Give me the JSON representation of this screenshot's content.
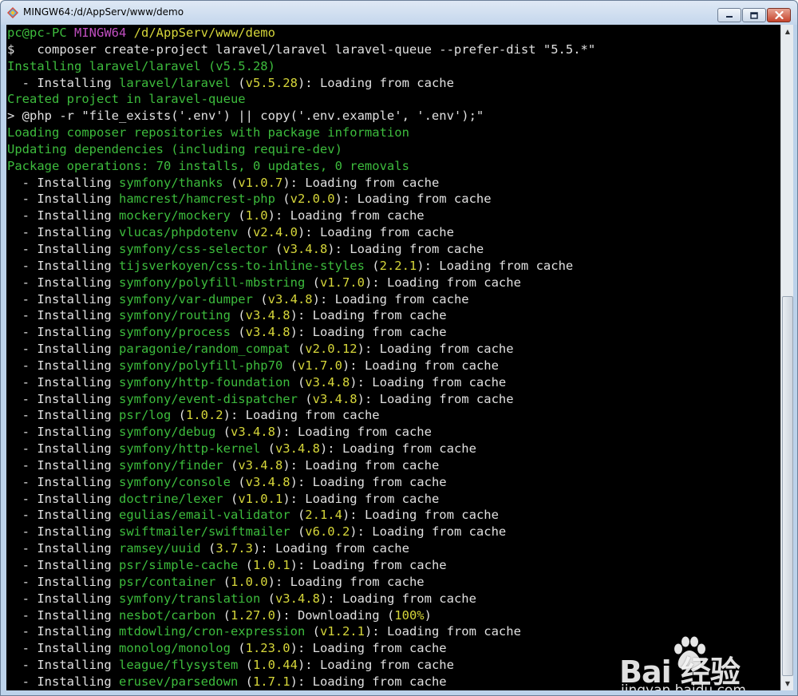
{
  "window": {
    "title": "MINGW64:/d/AppServ/www/demo"
  },
  "terminal": {
    "lines": [
      [
        [
          "g",
          "pc@pc-PC "
        ],
        [
          "m",
          "MINGW64 "
        ],
        [
          "y",
          "/d/AppServ/www/demo"
        ]
      ],
      [
        [
          "w",
          "$   composer create-project laravel/laravel laravel-queue --prefer-dist \"5.5.*\""
        ]
      ],
      [
        [
          "g",
          "Installing laravel/laravel (v5.5.28)"
        ]
      ],
      [
        [
          "w",
          "  - Installing "
        ],
        [
          "g",
          "laravel/laravel"
        ],
        [
          "w",
          " ("
        ],
        [
          "y",
          "v5.5.28"
        ],
        [
          "w",
          "): Loading from cache"
        ]
      ],
      [
        [
          "g",
          "Created project in laravel-queue"
        ]
      ],
      [
        [
          "w",
          "> @php -r \"file_exists('.env') || copy('.env.example', '.env');\""
        ]
      ],
      [
        [
          "g",
          "Loading composer repositories with package information"
        ]
      ],
      [
        [
          "g",
          "Updating dependencies (including require-dev)"
        ]
      ],
      [
        [
          "g",
          "Package operations: 70 installs, 0 updates, 0 removals"
        ]
      ],
      [
        [
          "w",
          "  - Installing "
        ],
        [
          "g",
          "symfony/thanks"
        ],
        [
          "w",
          " ("
        ],
        [
          "y",
          "v1.0.7"
        ],
        [
          "w",
          "): Loading from cache"
        ]
      ],
      [
        [
          "w",
          "  - Installing "
        ],
        [
          "g",
          "hamcrest/hamcrest-php"
        ],
        [
          "w",
          " ("
        ],
        [
          "y",
          "v2.0.0"
        ],
        [
          "w",
          "): Loading from cache"
        ]
      ],
      [
        [
          "w",
          "  - Installing "
        ],
        [
          "g",
          "mockery/mockery"
        ],
        [
          "w",
          " ("
        ],
        [
          "y",
          "1.0"
        ],
        [
          "w",
          "): Loading from cache"
        ]
      ],
      [
        [
          "w",
          "  - Installing "
        ],
        [
          "g",
          "vlucas/phpdotenv"
        ],
        [
          "w",
          " ("
        ],
        [
          "y",
          "v2.4.0"
        ],
        [
          "w",
          "): Loading from cache"
        ]
      ],
      [
        [
          "w",
          "  - Installing "
        ],
        [
          "g",
          "symfony/css-selector"
        ],
        [
          "w",
          " ("
        ],
        [
          "y",
          "v3.4.8"
        ],
        [
          "w",
          "): Loading from cache"
        ]
      ],
      [
        [
          "w",
          "  - Installing "
        ],
        [
          "g",
          "tijsverkoyen/css-to-inline-styles"
        ],
        [
          "w",
          " ("
        ],
        [
          "y",
          "2.2.1"
        ],
        [
          "w",
          "): Loading from cache"
        ]
      ],
      [
        [
          "w",
          "  - Installing "
        ],
        [
          "g",
          "symfony/polyfill-mbstring"
        ],
        [
          "w",
          " ("
        ],
        [
          "y",
          "v1.7.0"
        ],
        [
          "w",
          "): Loading from cache"
        ]
      ],
      [
        [
          "w",
          "  - Installing "
        ],
        [
          "g",
          "symfony/var-dumper"
        ],
        [
          "w",
          " ("
        ],
        [
          "y",
          "v3.4.8"
        ],
        [
          "w",
          "): Loading from cache"
        ]
      ],
      [
        [
          "w",
          "  - Installing "
        ],
        [
          "g",
          "symfony/routing"
        ],
        [
          "w",
          " ("
        ],
        [
          "y",
          "v3.4.8"
        ],
        [
          "w",
          "): Loading from cache"
        ]
      ],
      [
        [
          "w",
          "  - Installing "
        ],
        [
          "g",
          "symfony/process"
        ],
        [
          "w",
          " ("
        ],
        [
          "y",
          "v3.4.8"
        ],
        [
          "w",
          "): Loading from cache"
        ]
      ],
      [
        [
          "w",
          "  - Installing "
        ],
        [
          "g",
          "paragonie/random_compat"
        ],
        [
          "w",
          " ("
        ],
        [
          "y",
          "v2.0.12"
        ],
        [
          "w",
          "): Loading from cache"
        ]
      ],
      [
        [
          "w",
          "  - Installing "
        ],
        [
          "g",
          "symfony/polyfill-php70"
        ],
        [
          "w",
          " ("
        ],
        [
          "y",
          "v1.7.0"
        ],
        [
          "w",
          "): Loading from cache"
        ]
      ],
      [
        [
          "w",
          "  - Installing "
        ],
        [
          "g",
          "symfony/http-foundation"
        ],
        [
          "w",
          " ("
        ],
        [
          "y",
          "v3.4.8"
        ],
        [
          "w",
          "): Loading from cache"
        ]
      ],
      [
        [
          "w",
          "  - Installing "
        ],
        [
          "g",
          "symfony/event-dispatcher"
        ],
        [
          "w",
          " ("
        ],
        [
          "y",
          "v3.4.8"
        ],
        [
          "w",
          "): Loading from cache"
        ]
      ],
      [
        [
          "w",
          "  - Installing "
        ],
        [
          "g",
          "psr/log"
        ],
        [
          "w",
          " ("
        ],
        [
          "y",
          "1.0.2"
        ],
        [
          "w",
          "): Loading from cache"
        ]
      ],
      [
        [
          "w",
          "  - Installing "
        ],
        [
          "g",
          "symfony/debug"
        ],
        [
          "w",
          " ("
        ],
        [
          "y",
          "v3.4.8"
        ],
        [
          "w",
          "): Loading from cache"
        ]
      ],
      [
        [
          "w",
          "  - Installing "
        ],
        [
          "g",
          "symfony/http-kernel"
        ],
        [
          "w",
          " ("
        ],
        [
          "y",
          "v3.4.8"
        ],
        [
          "w",
          "): Loading from cache"
        ]
      ],
      [
        [
          "w",
          "  - Installing "
        ],
        [
          "g",
          "symfony/finder"
        ],
        [
          "w",
          " ("
        ],
        [
          "y",
          "v3.4.8"
        ],
        [
          "w",
          "): Loading from cache"
        ]
      ],
      [
        [
          "w",
          "  - Installing "
        ],
        [
          "g",
          "symfony/console"
        ],
        [
          "w",
          " ("
        ],
        [
          "y",
          "v3.4.8"
        ],
        [
          "w",
          "): Loading from cache"
        ]
      ],
      [
        [
          "w",
          "  - Installing "
        ],
        [
          "g",
          "doctrine/lexer"
        ],
        [
          "w",
          " ("
        ],
        [
          "y",
          "v1.0.1"
        ],
        [
          "w",
          "): Loading from cache"
        ]
      ],
      [
        [
          "w",
          "  - Installing "
        ],
        [
          "g",
          "egulias/email-validator"
        ],
        [
          "w",
          " ("
        ],
        [
          "y",
          "2.1.4"
        ],
        [
          "w",
          "): Loading from cache"
        ]
      ],
      [
        [
          "w",
          "  - Installing "
        ],
        [
          "g",
          "swiftmailer/swiftmailer"
        ],
        [
          "w",
          " ("
        ],
        [
          "y",
          "v6.0.2"
        ],
        [
          "w",
          "): Loading from cache"
        ]
      ],
      [
        [
          "w",
          "  - Installing "
        ],
        [
          "g",
          "ramsey/uuid"
        ],
        [
          "w",
          " ("
        ],
        [
          "y",
          "3.7.3"
        ],
        [
          "w",
          "): Loading from cache"
        ]
      ],
      [
        [
          "w",
          "  - Installing "
        ],
        [
          "g",
          "psr/simple-cache"
        ],
        [
          "w",
          " ("
        ],
        [
          "y",
          "1.0.1"
        ],
        [
          "w",
          "): Loading from cache"
        ]
      ],
      [
        [
          "w",
          "  - Installing "
        ],
        [
          "g",
          "psr/container"
        ],
        [
          "w",
          " ("
        ],
        [
          "y",
          "1.0.0"
        ],
        [
          "w",
          "): Loading from cache"
        ]
      ],
      [
        [
          "w",
          "  - Installing "
        ],
        [
          "g",
          "symfony/translation"
        ],
        [
          "w",
          " ("
        ],
        [
          "y",
          "v3.4.8"
        ],
        [
          "w",
          "): Loading from cache"
        ]
      ],
      [
        [
          "w",
          "  - Installing "
        ],
        [
          "g",
          "nesbot/carbon"
        ],
        [
          "w",
          " ("
        ],
        [
          "y",
          "1.27.0"
        ],
        [
          "w",
          "): Downloading ("
        ],
        [
          "y",
          "100%"
        ],
        [
          "w",
          ")"
        ]
      ],
      [
        [
          "w",
          "  - Installing "
        ],
        [
          "g",
          "mtdowling/cron-expression"
        ],
        [
          "w",
          " ("
        ],
        [
          "y",
          "v1.2.1"
        ],
        [
          "w",
          "): Loading from cache"
        ]
      ],
      [
        [
          "w",
          "  - Installing "
        ],
        [
          "g",
          "monolog/monolog"
        ],
        [
          "w",
          " ("
        ],
        [
          "y",
          "1.23.0"
        ],
        [
          "w",
          "): Loading from cache"
        ]
      ],
      [
        [
          "w",
          "  - Installing "
        ],
        [
          "g",
          "league/flysystem"
        ],
        [
          "w",
          " ("
        ],
        [
          "y",
          "1.0.44"
        ],
        [
          "w",
          "): Loading from cache"
        ]
      ],
      [
        [
          "w",
          "  - Installing "
        ],
        [
          "g",
          "erusev/parsedown"
        ],
        [
          "w",
          " ("
        ],
        [
          "y",
          "1.7.1"
        ],
        [
          "w",
          "): Loading from cache"
        ]
      ]
    ]
  },
  "watermark": {
    "main": "Bai  经验",
    "sub": "jingyan.baidu.com"
  },
  "icons": {
    "app": "mingw-logo-icon",
    "minimize": "minimize-icon",
    "maximize": "maximize-icon",
    "close": "close-icon"
  }
}
